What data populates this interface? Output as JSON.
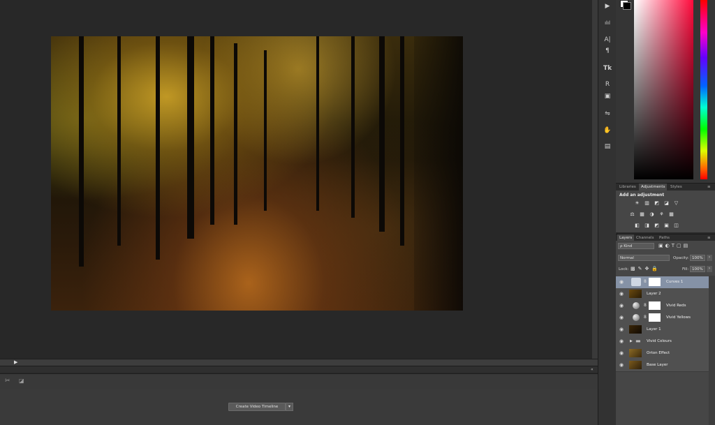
{
  "document": {
    "image_desc_icon": "autumn-forest-path-image"
  },
  "timeline": {
    "play_icon": "play-icon",
    "create_button": "Create Video Timeline",
    "dropdown_glyph": "▾"
  },
  "tools_col": {
    "icons": [
      "▶",
      "ılıl",
      "A|",
      "¶",
      "Tk",
      "R",
      "▣",
      "⇋",
      "✋",
      "▤"
    ]
  },
  "panels": {
    "top_tabs": [
      "Libraries",
      "Adjustments",
      "Styles"
    ],
    "adjustments": {
      "title": "Add an adjustment",
      "row1": [
        "☀",
        "▥",
        "◩",
        "◪",
        "▽"
      ],
      "row2": [
        "⚖",
        "▦",
        "◑",
        "⚘",
        "▦"
      ],
      "row3": [
        "◧",
        "◨",
        "◩",
        "▣",
        "◫"
      ]
    }
  },
  "layers": {
    "tabs": [
      "Layers",
      "Channels",
      "Paths"
    ],
    "kind_label": "ρ Kind",
    "blend_mode": "Normal",
    "opacity_label": "Opacity:",
    "opacity_value": "100%",
    "lock_label": "Lock:",
    "fill_label": "Fill:",
    "fill_value": "100%",
    "rows": [
      {
        "name": "Curves 1",
        "type": "adjustment-mask",
        "selected": true
      },
      {
        "name": "Layer 2",
        "type": "image"
      },
      {
        "name": "Vivid Reds",
        "type": "adjustment-mask"
      },
      {
        "name": "Vivid Yellows",
        "type": "adjustment-mask"
      },
      {
        "name": "Layer 1",
        "type": "image-dark"
      },
      {
        "name": "Vivid Colours",
        "type": "group"
      },
      {
        "name": "Orton Effect",
        "type": "image"
      },
      {
        "name": "Base Layer",
        "type": "image"
      }
    ]
  }
}
